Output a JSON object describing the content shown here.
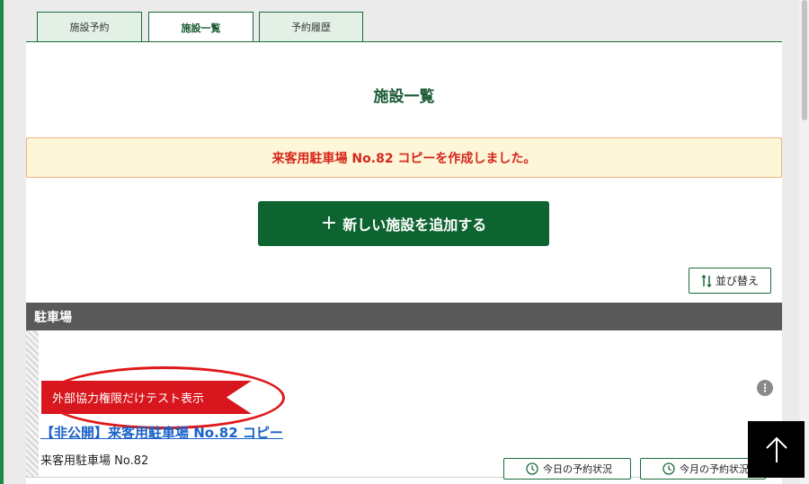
{
  "tabs": [
    {
      "label": "施設予約"
    },
    {
      "label": "施設一覧"
    },
    {
      "label": "予約履歴"
    }
  ],
  "active_tab": "施設一覧",
  "page_title": "施設一覧",
  "notice": "来客用駐車場 No.82 コピーを作成しました。",
  "add_button": {
    "icon": "+",
    "label": "新しい施設を追加する"
  },
  "sort_button": {
    "label": "並び替え"
  },
  "section": {
    "title": "駐車場"
  },
  "facility": {
    "ribbon": "外部協力権限だけテスト表示",
    "name": "【非公開】来客用駐車場 No.82 コピー",
    "sub": "来客用駐車場 No.82",
    "today_status": "今日の予約状況",
    "month_status": "今月の予約状況"
  },
  "colors": {
    "accent_green": "#0e6431",
    "notice_red": "#d6261b",
    "link_blue": "#1a62c8",
    "section_gray": "#595959",
    "ribbon_red": "#d8161e"
  },
  "icons": [
    "sort-arrows-icon",
    "more-options-icon",
    "clock-icon",
    "arrow-up-icon"
  ]
}
